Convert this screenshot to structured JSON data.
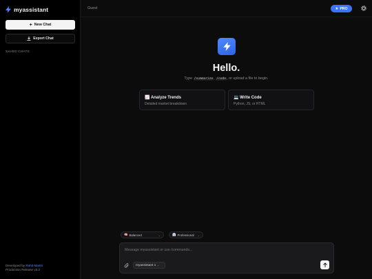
{
  "sidebar": {
    "brand": "myassistant",
    "new_chat": "New Chat",
    "export_chat": "Export Chat",
    "saved_label": "SAVED CHATS",
    "footer_prefix": "Developed by ",
    "footer_name": "Rohit Mantri",
    "footer_release": "Production Release v3.2"
  },
  "topbar": {
    "user": "Guest",
    "badge": "PRO"
  },
  "hero": {
    "title": "Hello.",
    "sub_before": "Type ",
    "cmd_1": "/summarize",
    "sep": ", ",
    "cmd_2": "/code",
    "sub_after": ", or upload a file to begin."
  },
  "cards": [
    {
      "emoji": "📈",
      "title": "Analyze Trends",
      "desc": "Detailed market breakdown"
    },
    {
      "emoji": "💻",
      "title": "Write Code",
      "desc": "Python, JS, or HTML"
    }
  ],
  "controls": {
    "mode_emoji": "🧠",
    "mode": "Balanced",
    "tone_emoji": "👔",
    "tone": "Professional"
  },
  "composer": {
    "placeholder": "Message myassistant or use /commands...",
    "model": "myassistant 1"
  },
  "colors": {
    "accent": "#3b74f6",
    "link": "#5a8cff",
    "background": "#0c0c0d"
  }
}
